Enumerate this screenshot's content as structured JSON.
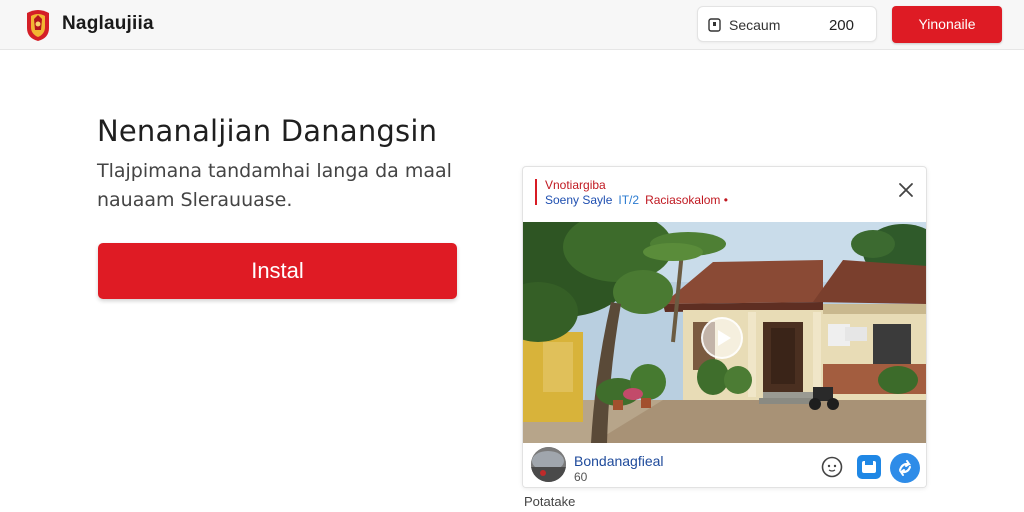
{
  "header": {
    "brand": "Naglaujiia",
    "search_label": "Secaum",
    "search_count": "200",
    "cta_label": "Yinonaile"
  },
  "hero": {
    "title": "Nenanaljian Danangsin",
    "subtitle": "Tlajpimana tandamhai langa  da maal nauaam Slerauuase.",
    "install_label": "Instal"
  },
  "card": {
    "title": "Vnotiargiba",
    "sub_a": "Soeny Sayle",
    "sub_b": "IT/2",
    "sub_c": "Raciasokalom •",
    "author": "Bondanagfieal",
    "meta": "60"
  },
  "caption": "Potatake",
  "colors": {
    "accent": "#de1b24",
    "link_blue": "#1e4a9b",
    "action_blue": "#2e8ce8"
  },
  "icons": [
    "crest-logo-icon",
    "search-icon",
    "close-icon",
    "play-icon",
    "comment-icon",
    "save-icon",
    "share-icon"
  ]
}
